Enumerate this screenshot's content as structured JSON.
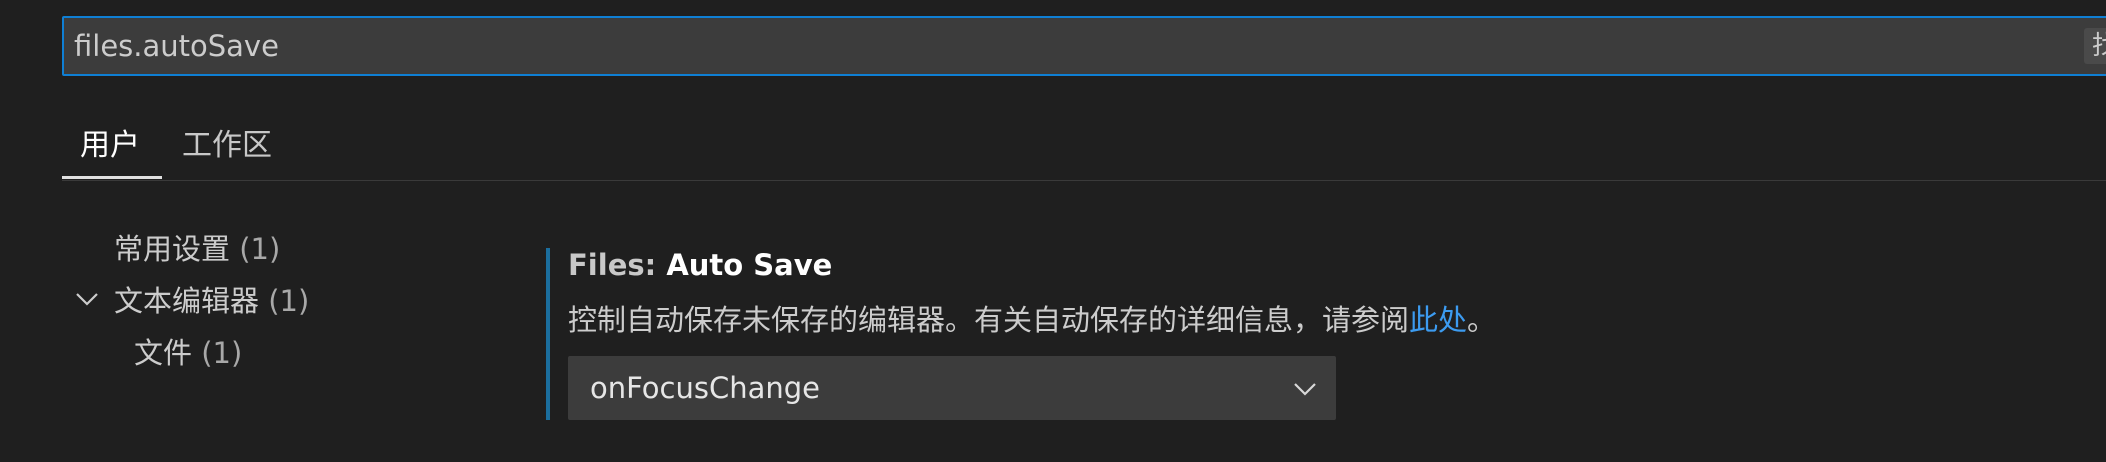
{
  "search": {
    "value": "files.autoSave",
    "badge": "找"
  },
  "tabs": [
    {
      "label": "用户",
      "active": true
    },
    {
      "label": "工作区",
      "active": false
    }
  ],
  "tree": {
    "items": [
      {
        "label": "常用设置",
        "count": "(1)"
      },
      {
        "label": "文本编辑器",
        "count": "(1)"
      },
      {
        "label": "文件",
        "count": "(1)"
      }
    ]
  },
  "setting": {
    "title_prefix": "Files: ",
    "title_name": "Auto Save",
    "description": "控制自动保存未保存的编辑器。有关自动保存的详细信息，请参阅",
    "description_link": "此处",
    "description_suffix": "。",
    "value": "onFocusChange"
  },
  "icons": {
    "tree_expander": "chevron-down-icon",
    "dropdown": "chevron-down-icon"
  },
  "colors": {
    "background": "#1f1f1f",
    "focus_border": "#0f7fd4",
    "link": "#3c9bf0",
    "accent_bar": "#1b6e9e"
  }
}
